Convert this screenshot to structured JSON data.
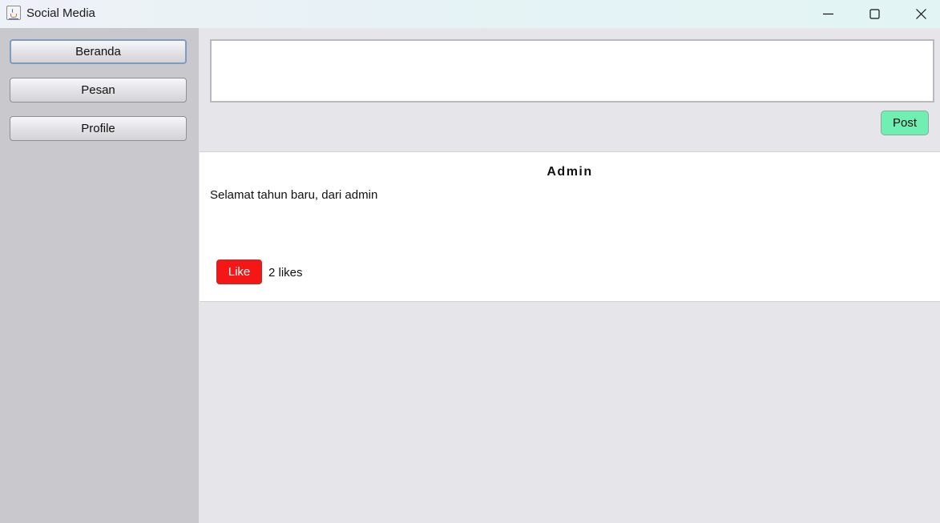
{
  "window": {
    "title": "Social Media",
    "icon": "java-cup-icon"
  },
  "sidebar": {
    "items": [
      {
        "label": "Beranda",
        "active": true
      },
      {
        "label": "Pesan",
        "active": false
      },
      {
        "label": "Profile",
        "active": false
      }
    ]
  },
  "composer": {
    "value": "",
    "post_label": "Post",
    "post_color": "#6ff0b2"
  },
  "posts": [
    {
      "author": "Admin",
      "content": "Selamat tahun baru, dari admin",
      "like_label": "Like",
      "likes_text": "2 likes",
      "like_color": "#f51616"
    }
  ]
}
